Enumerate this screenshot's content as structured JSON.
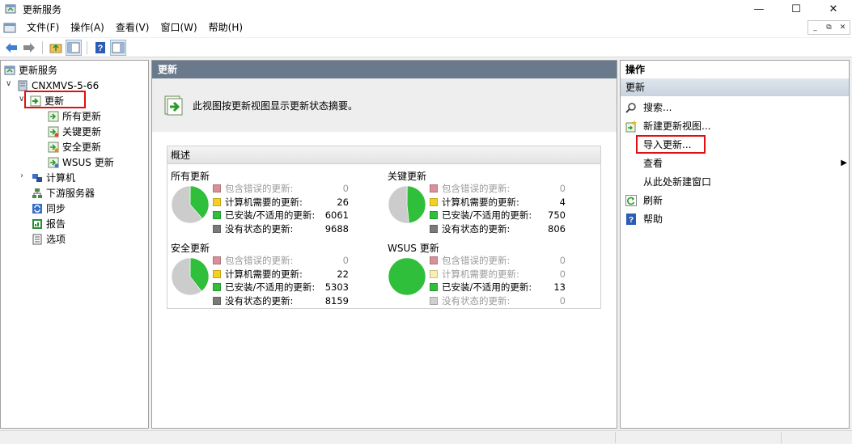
{
  "window": {
    "title": "更新服务"
  },
  "menu": [
    "文件(F)",
    "操作(A)",
    "查看(V)",
    "窗口(W)",
    "帮助(H)"
  ],
  "tree": {
    "root": "更新服务",
    "server": "CNXMVS-5-66",
    "updates": "更新",
    "update_children": [
      "所有更新",
      "关键更新",
      "安全更新",
      "WSUS 更新"
    ],
    "computers": "计算机",
    "downstream": "下游服务器",
    "sync": "同步",
    "reports": "报告",
    "options": "选项"
  },
  "center": {
    "header": "更新",
    "banner": "此视图按更新视图显示更新状态摘要。",
    "overview_title": "概述",
    "groups": [
      {
        "title": "所有更新",
        "rows": [
          {
            "label": "包含错误的更新:",
            "value": "0",
            "muted": true,
            "color": "#d9909a"
          },
          {
            "label": "计算机需要的更新:",
            "value": "26",
            "muted": false,
            "color": "#f5d020"
          },
          {
            "label": "已安装/不适用的更新:",
            "value": "6061",
            "muted": false,
            "color": "#2fbf3a"
          },
          {
            "label": "没有状态的更新:",
            "value": "9688",
            "muted": false,
            "color": "#7a7a7a"
          }
        ]
      },
      {
        "title": "关键更新",
        "rows": [
          {
            "label": "包含错误的更新:",
            "value": "0",
            "muted": true,
            "color": "#d9909a"
          },
          {
            "label": "计算机需要的更新:",
            "value": "4",
            "muted": false,
            "color": "#f5d020"
          },
          {
            "label": "已安装/不适用的更新:",
            "value": "750",
            "muted": false,
            "color": "#2fbf3a"
          },
          {
            "label": "没有状态的更新:",
            "value": "806",
            "muted": false,
            "color": "#7a7a7a"
          }
        ]
      },
      {
        "title": "安全更新",
        "rows": [
          {
            "label": "包含错误的更新:",
            "value": "0",
            "muted": true,
            "color": "#d9909a"
          },
          {
            "label": "计算机需要的更新:",
            "value": "22",
            "muted": false,
            "color": "#f5d020"
          },
          {
            "label": "已安装/不适用的更新:",
            "value": "5303",
            "muted": false,
            "color": "#2fbf3a"
          },
          {
            "label": "没有状态的更新:",
            "value": "8159",
            "muted": false,
            "color": "#7a7a7a"
          }
        ]
      },
      {
        "title": "WSUS 更新",
        "rows": [
          {
            "label": "包含错误的更新:",
            "value": "0",
            "muted": true,
            "color": "#d9909a"
          },
          {
            "label": "计算机需要的更新:",
            "value": "0",
            "muted": true,
            "color": "#f8eeb0"
          },
          {
            "label": "已安装/不适用的更新:",
            "value": "13",
            "muted": false,
            "color": "#2fbf3a"
          },
          {
            "label": "没有状态的更新:",
            "value": "0",
            "muted": true,
            "color": "#cfcfcf"
          }
        ]
      }
    ]
  },
  "actions": {
    "header": "操作",
    "section": "更新",
    "items": [
      "搜索...",
      "新建更新视图...",
      "导入更新...",
      "查看",
      "从此处新建窗口",
      "刷新",
      "帮助"
    ]
  },
  "colors": {
    "pane_header": "#6a7a8c",
    "highlight_box": "#e01010",
    "pie_green": "#2fbf3a",
    "pie_gray": "#cccccc"
  }
}
